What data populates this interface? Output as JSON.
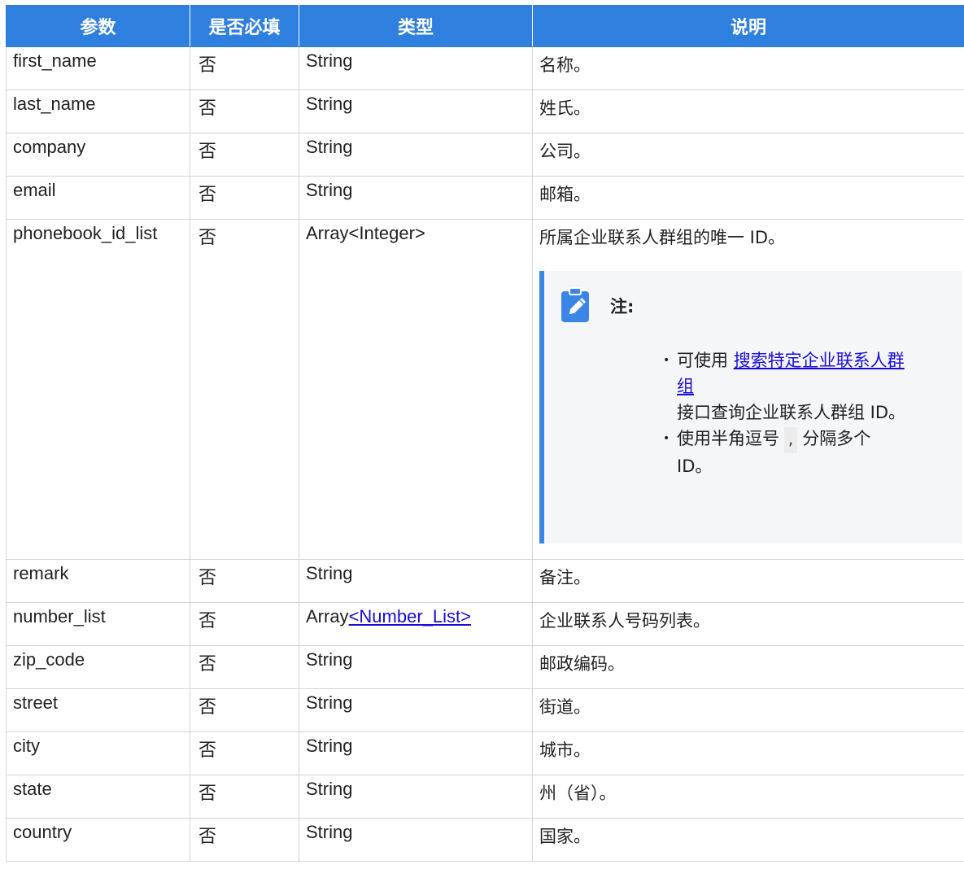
{
  "table": {
    "headers": [
      "参数",
      "是否必填",
      "类型",
      "说明"
    ],
    "rows": [
      {
        "param": "first_name",
        "required": "否",
        "type": "String",
        "desc": "名称。"
      },
      {
        "param": "last_name",
        "required": "否",
        "type": "String",
        "desc": "姓氏。"
      },
      {
        "param": "company",
        "required": "否",
        "type": "String",
        "desc": "公司。"
      },
      {
        "param": "email",
        "required": "否",
        "type": "String",
        "desc": "邮箱。"
      },
      {
        "param": "phonebook_id_list",
        "required": "否",
        "type": "Array<Integer>",
        "desc": "所属企业联系人群组的唯一 ID。"
      },
      {
        "param": "remark",
        "required": "否",
        "type": "String",
        "desc": "备注。"
      },
      {
        "param": "number_list",
        "required": "否",
        "type_prefix": "Array",
        "type_link": "<Number_List>",
        "desc": "企业联系人号码列表。"
      },
      {
        "param": "zip_code",
        "required": "否",
        "type": "String",
        "desc": "邮政编码。"
      },
      {
        "param": "street",
        "required": "否",
        "type": "String",
        "desc": "街道。"
      },
      {
        "param": "city",
        "required": "否",
        "type": "String",
        "desc": "城市。"
      },
      {
        "param": "state",
        "required": "否",
        "type": "String",
        "desc": "州（省）。"
      },
      {
        "param": "country",
        "required": "否",
        "type": "String",
        "desc": "国家。"
      }
    ]
  },
  "note": {
    "icon": "edit-note-icon",
    "title": "注:",
    "item1_prefix": "可使用 ",
    "item1_link": "搜索特定企业联系人群组",
    "item1_suffix": "接口查询企业联系人群组 ID。",
    "item2_prefix": "使用半角逗号",
    "item2_code": ",",
    "item2_suffix": "分隔多个 ID。"
  },
  "colors": {
    "header_bg": "#2f7fde",
    "note_border": "#3b85e6",
    "link": "#1a0dd6"
  }
}
